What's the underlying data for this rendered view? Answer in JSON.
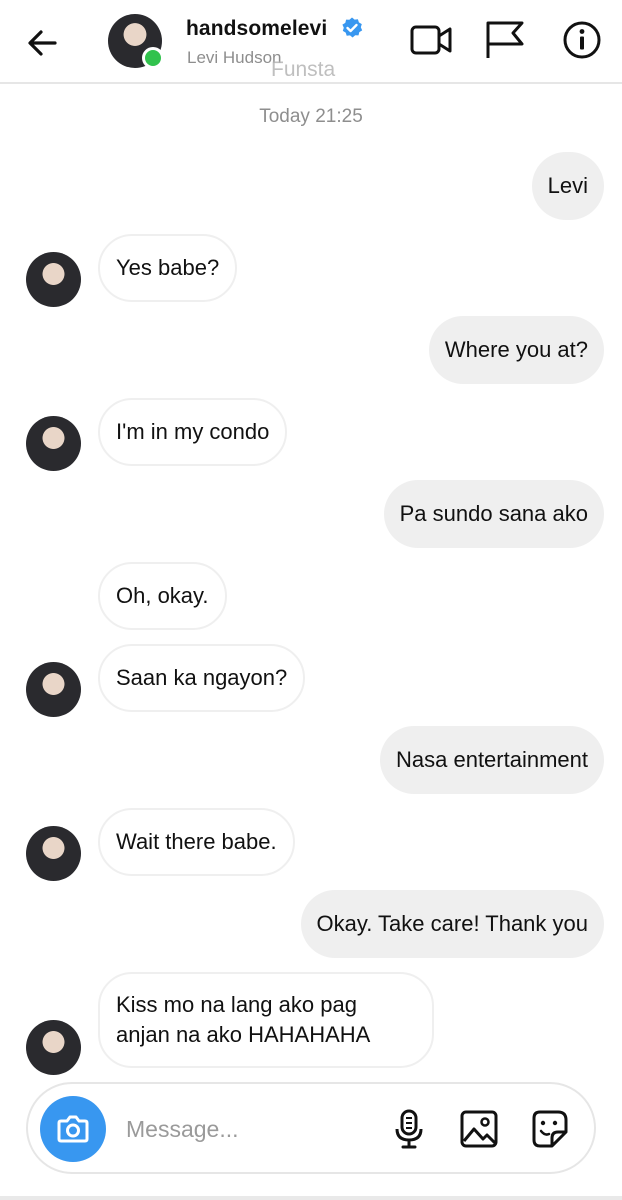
{
  "header": {
    "username": "handsomelevi",
    "full_name": "Levi Hudson",
    "watermark": "Funsta",
    "icons": [
      "back-arrow-icon",
      "verified-badge-icon",
      "video-call-icon",
      "flag-icon",
      "info-icon"
    ]
  },
  "timestamp": "Today 21:25",
  "messages": [
    {
      "from": "me",
      "text": "Levi"
    },
    {
      "from": "them",
      "text": "Yes babe?"
    },
    {
      "from": "me",
      "text": "Where you at?"
    },
    {
      "from": "them",
      "text": "I'm in my condo"
    },
    {
      "from": "me",
      "text": "Pa sundo sana ako"
    },
    {
      "from": "them",
      "text": "Oh, okay."
    },
    {
      "from": "them",
      "text": "Saan ka ngayon?"
    },
    {
      "from": "me",
      "text": "Nasa entertainment"
    },
    {
      "from": "them",
      "text": "Wait there babe."
    },
    {
      "from": "me",
      "text": "Okay. Take care! Thank you"
    },
    {
      "from": "them",
      "text": "Kiss mo na lang ako pag anjan na ako HAHAHAHA"
    }
  ],
  "composer": {
    "placeholder": "Message...",
    "icons": [
      "camera-icon",
      "microphone-icon",
      "gallery-icon",
      "sticker-icon"
    ]
  },
  "colors": {
    "accent_blue": "#3897f0",
    "online_green": "#31c24d",
    "sent_bubble": "#efefef",
    "muted_text": "#8e8e8e"
  }
}
